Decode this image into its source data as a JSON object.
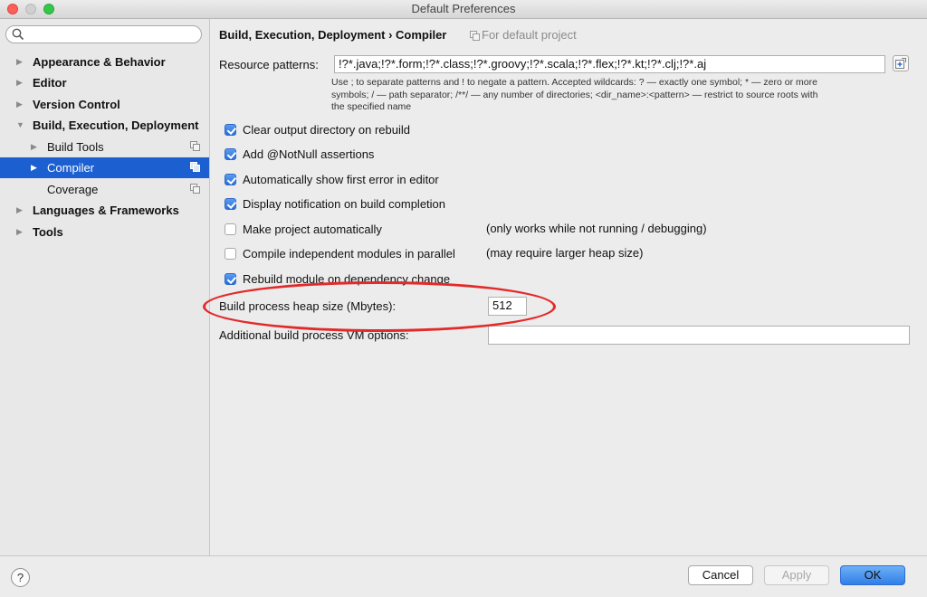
{
  "window": {
    "title": "Default Preferences"
  },
  "search": {
    "placeholder": ""
  },
  "sidebar": {
    "items": [
      {
        "label": "Appearance & Behavior"
      },
      {
        "label": "Editor"
      },
      {
        "label": "Version Control"
      },
      {
        "label": "Build, Execution, Deployment"
      },
      {
        "label": "Build Tools"
      },
      {
        "label": "Compiler"
      },
      {
        "label": "Coverage"
      },
      {
        "label": "Languages & Frameworks"
      },
      {
        "label": "Tools"
      }
    ]
  },
  "header": {
    "breadcrumb": "Build, Execution, Deployment › Compiler",
    "scope_note": "For default project"
  },
  "resource_patterns": {
    "label": "Resource patterns:",
    "value": "!?*.java;!?*.form;!?*.class;!?*.groovy;!?*.scala;!?*.flex;!?*.kt;!?*.clj;!?*.aj",
    "hint_line1": "Use ; to separate patterns and ! to negate a pattern. Accepted wildcards: ? — exactly one symbol; * — zero or more",
    "hint_line2": "symbols; / — path separator; /**/ — any number of directories; <dir_name>:<pattern> — restrict to source roots with",
    "hint_line3": "the specified name"
  },
  "options": [
    {
      "label": "Clear output directory on rebuild",
      "checked": true
    },
    {
      "label": "Add @NotNull assertions",
      "checked": true
    },
    {
      "label": "Automatically show first error in editor",
      "checked": true
    },
    {
      "label": "Display notification on build completion",
      "checked": true
    },
    {
      "label": "Make project automatically",
      "checked": false,
      "note": "(only works while not running / debugging)"
    },
    {
      "label": "Compile independent modules in parallel",
      "checked": false,
      "note": "(may require larger heap size)"
    },
    {
      "label": "Rebuild module on dependency change",
      "checked": true
    }
  ],
  "heap": {
    "label": "Build process heap size (Mbytes):",
    "value": "512"
  },
  "vm_options": {
    "label": "Additional build process VM options:",
    "value": ""
  },
  "buttons": {
    "help": "?",
    "cancel": "Cancel",
    "apply": "Apply",
    "ok": "OK"
  },
  "colors": {
    "selection": "#1b5fd0",
    "annotation": "#e32a2a",
    "primary_button": "#2f7fe8"
  }
}
